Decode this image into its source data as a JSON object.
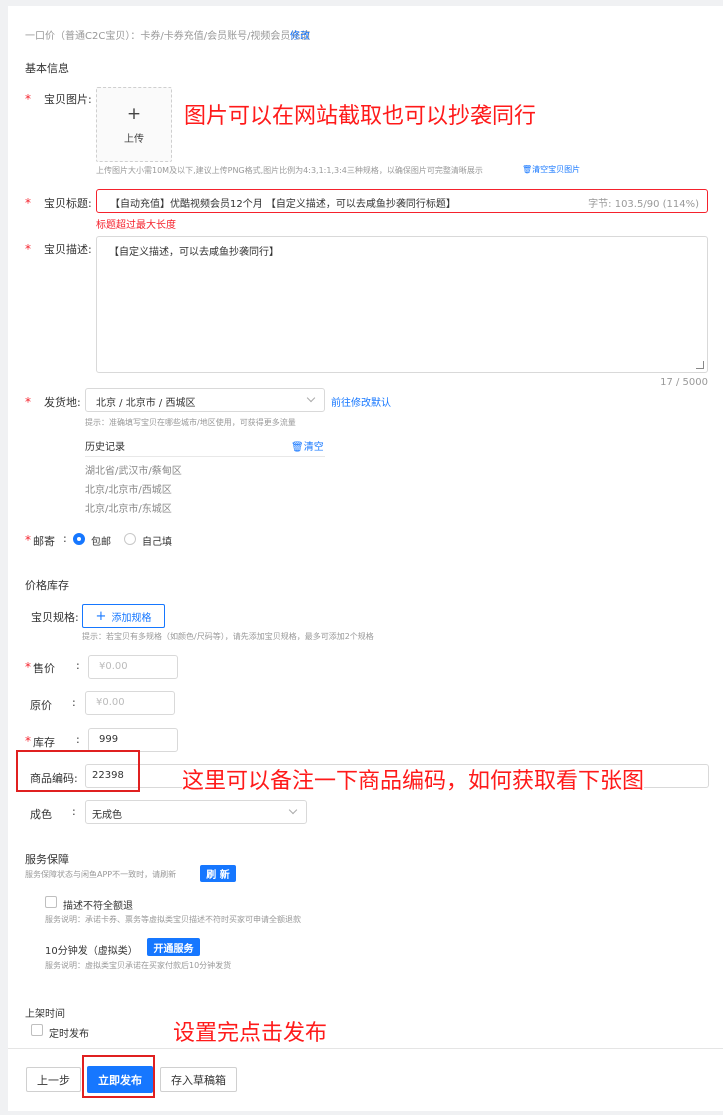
{
  "category": {
    "text": "一口价（普通C2C宝贝）：卡券/卡券充值/会员账号/视频会员充值",
    "modify": "修改"
  },
  "basic": {
    "section": "基本信息",
    "image_label": "宝贝图片:",
    "upload_plus": "+",
    "upload_label": "上传",
    "image_hint": "上传图片大小需10M及以下,建议上传PNG格式,图片比例为4:3,1:1,3:4三种规格，以确保图片可完整清晰展示",
    "clear_images": "清空宝贝图片",
    "title_label": "宝贝标题:",
    "title_value": "【自动充值】优酷视频会员12个月 【自定义描述，可以去咸鱼抄袭同行标题】",
    "title_count": "字节: 103.5/90 (114%)",
    "title_error": "标题超过最大长度",
    "desc_label": "宝贝描述:",
    "desc_value": "【自定义描述，可以去咸鱼抄袭同行】",
    "desc_count": "17 / 5000",
    "ship_label": "发货地:",
    "ship_value": "北京 / 北京市 / 西城区",
    "ship_default": "前往修改默认",
    "ship_hint": "提示：准确填写宝贝在哪些城市/地区使用，可获得更多流量",
    "history_title": "历史记录",
    "history_clear": "清空",
    "history": [
      "湖北省/武汉市/蔡甸区",
      "北京/北京市/西城区",
      "北京/北京市/东城区"
    ],
    "postage_label": "邮寄",
    "postage_opt1": "包邮",
    "postage_opt2": "自己填"
  },
  "price": {
    "section": "价格库存",
    "spec_label": "宝贝规格:",
    "spec_button": "添加规格",
    "spec_hint": "提示：若宝贝有多规格（如颜色/尺码等），请先添加宝贝规格，最多可添加2个规格",
    "sale_label": "售价",
    "sale_placeholder": "¥0.00",
    "orig_label": "原价",
    "orig_placeholder": "¥0.00",
    "stock_label": "库存",
    "stock_value": "999",
    "code_label": "商品编码:",
    "code_value": "22398",
    "cond_label": "成色",
    "cond_value": "无成色"
  },
  "service": {
    "section": "服务保障",
    "sync_hint": "服务保障状态与闲鱼APP不一致时，请刷新",
    "refresh": "刷 新",
    "refund_label": "描述不符全额退",
    "refund_desc": "服务说明：承诺卡券、票务等虚拟类宝贝描述不符时买家可申请全额退款",
    "fast_label": "10分钟发（虚拟类）",
    "fast_btn": "开通服务",
    "fast_desc": "服务说明：虚拟类宝贝承诺在买家付款后10分钟发货"
  },
  "listing": {
    "section": "上架时间",
    "scheduled": "定时发布"
  },
  "footer": {
    "prev": "上一步",
    "publish": "立即发布",
    "draft": "存入草稿箱"
  },
  "annotations": {
    "image": "图片可以在网站截取也可以抄袭同行",
    "code": "这里可以备注一下商品编码，如何获取看下张图",
    "publish": "设置完点击发布"
  }
}
